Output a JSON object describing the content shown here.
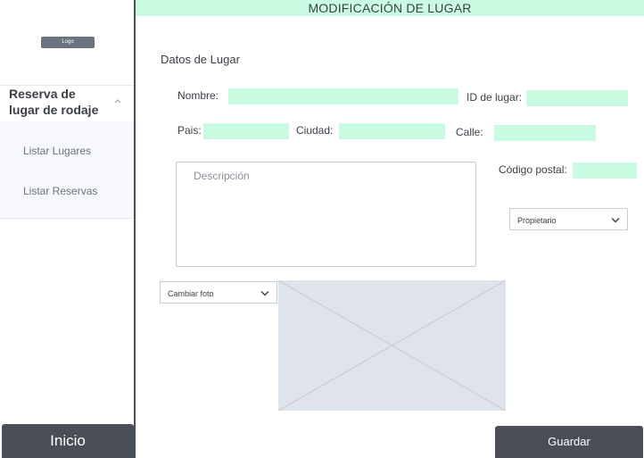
{
  "sidebar": {
    "logo_label": "Logo",
    "section_title": "Reserva de lugar de rodaje",
    "items": [
      {
        "label": "Listar Lugares"
      },
      {
        "label": "Listar Reservas"
      }
    ],
    "home_button": "Inicio"
  },
  "header": {
    "title": "MODIFICACIÓN DE LUGAR"
  },
  "form": {
    "section_label": "Datos de Lugar",
    "nombre": {
      "label": "Nombre:",
      "value": ""
    },
    "id_lugar": {
      "label": "ID de lugar:",
      "value": ""
    },
    "pais": {
      "label": "Pais:",
      "value": ""
    },
    "ciudad": {
      "label": "Ciudad:",
      "value": ""
    },
    "calle": {
      "label": "Calle:",
      "value": ""
    },
    "codigo_postal": {
      "label": "Código postal:",
      "value": ""
    },
    "descripcion": {
      "placeholder": "Descripción"
    },
    "propietario": {
      "selected": "Propietario"
    },
    "foto": {
      "selected": "Cambiar foto"
    },
    "save_button": "Guardar"
  },
  "colors": {
    "accent_field": "#c9fbe3",
    "dark_button": "#4a4f57",
    "image_placeholder": "#dfe4eb"
  }
}
